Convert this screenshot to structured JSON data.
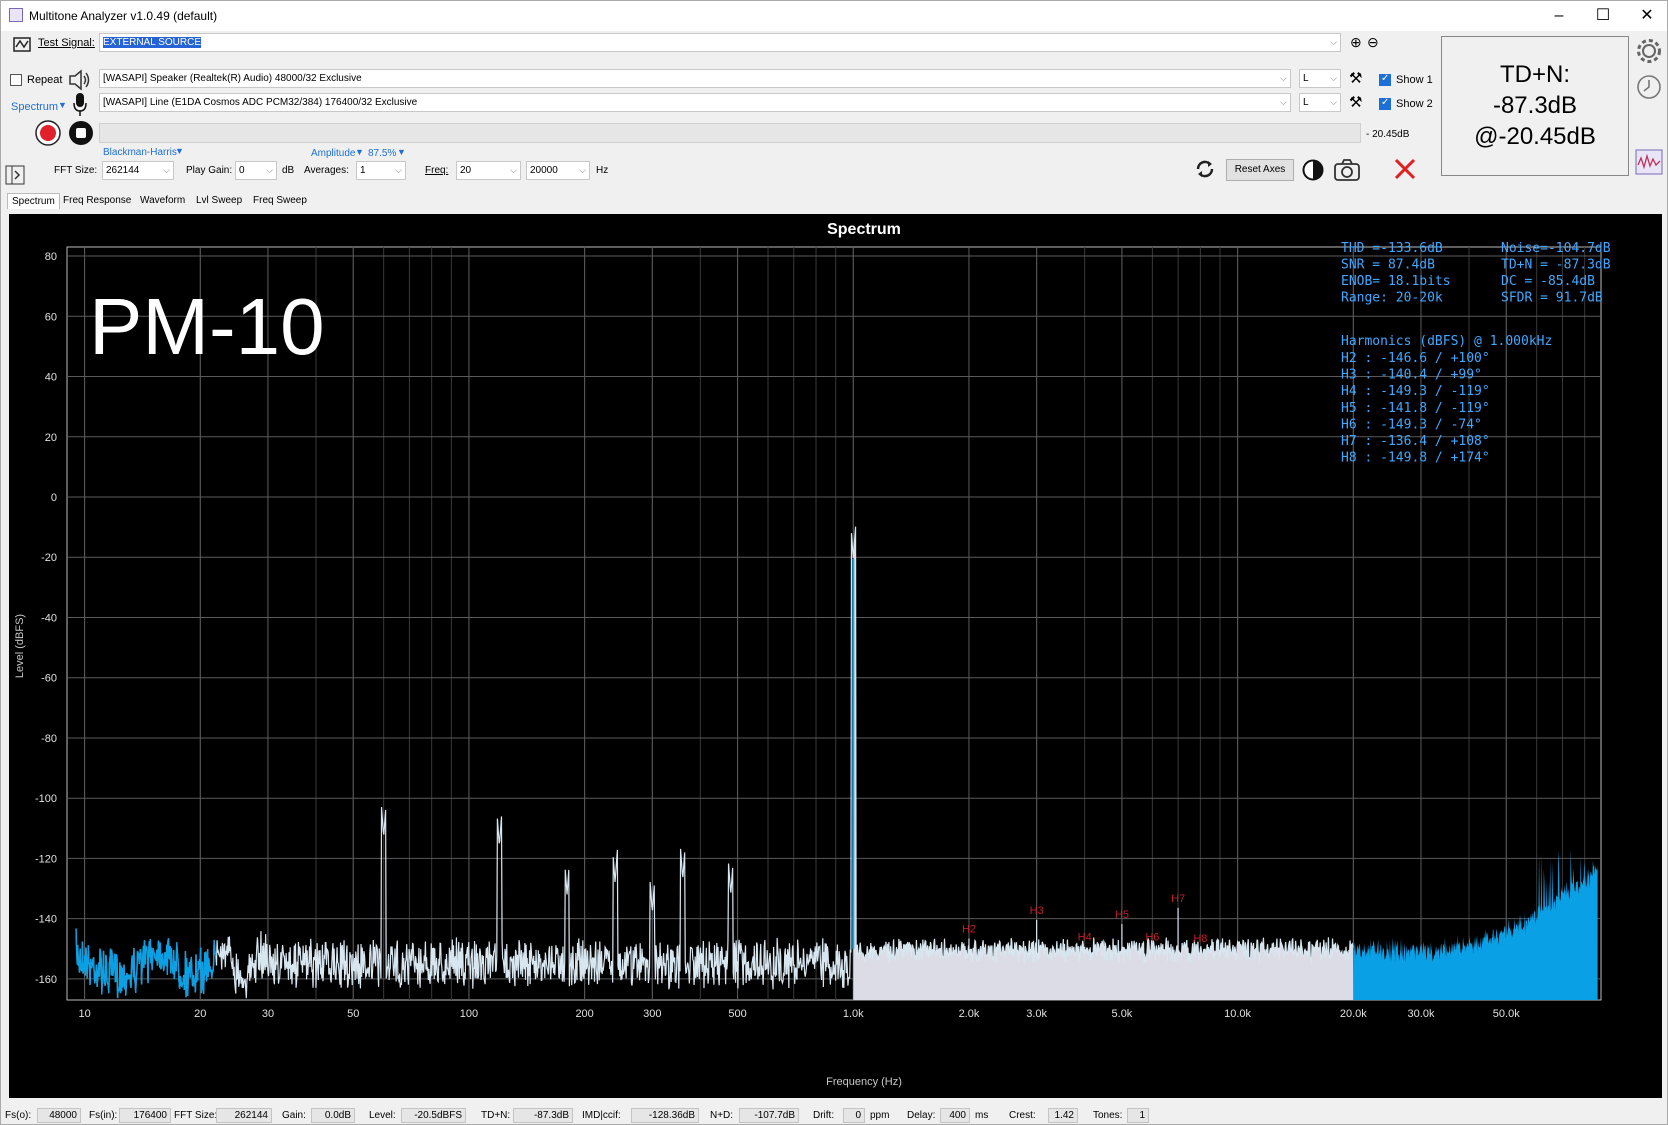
{
  "window": {
    "title": "Multitone Analyzer v1.0.49 (default)"
  },
  "toolbar": {
    "test_signal_label": "Test Signal:",
    "test_signal_value": "EXTERNAL SOURCE",
    "repeat_label": "Repeat",
    "spectrum_label": "Spectrum",
    "output_device": "[WASAPI] Speaker (Realtek(R) Audio) 48000/32 Exclusive",
    "input_device": "[WASAPI] Line (E1DA Cosmos ADC PCM32/384) 176400/32 Exclusive",
    "out_channel": "L",
    "in_channel": "L",
    "show1_label": "Show 1",
    "show2_label": "Show 2",
    "level_readout": "- 20.45dB",
    "window_func": "Blackman-Harris",
    "amplitude_label": "Amplitude",
    "amplitude_value": "87.5%",
    "fft_size_label": "FFT Size:",
    "fft_size_value": "262144",
    "play_gain_label": "Play Gain:",
    "play_gain_value": "0",
    "play_gain_unit": "dB",
    "averages_label": "Averages:",
    "averages_value": "1",
    "freq_label": "Freq:",
    "freq_from": "20",
    "freq_to": "20000",
    "freq_unit": "Hz",
    "reset_axes_label": "Reset Axes"
  },
  "tdn_panel": {
    "line1": "TD+N:",
    "line2": "-87.3dB",
    "line3": "@-20.45dB"
  },
  "tabs": [
    "Spectrum",
    "Freq Response",
    "Waveform",
    "Lvl Sweep",
    "Freq Sweep"
  ],
  "overlay_label": "PM-10",
  "stats": {
    "rows": [
      [
        "THD =-133.6dB",
        "Noise=-104.7dB"
      ],
      [
        "SNR =  87.4dB",
        "TD+N = -87.3dB"
      ],
      [
        "ENOB= 18.1bits",
        "DC   = -85.4dB"
      ],
      [
        "Range: 20-20k",
        "SFDR =  91.7dB"
      ]
    ],
    "harmonics_title": "Harmonics (dBFS) @ 1.000kHz",
    "harmonics": [
      "H2 :  -146.6 / +100°",
      "H3 :  -140.4 /  +99°",
      "H4 :  -149.3 / -119°",
      "H5 :  -141.8 / -119°",
      "H6 :  -149.3 /  -74°",
      "H7 :  -136.4 / +108°",
      "H8 :  -149.8 / +174°"
    ]
  },
  "chart_data": {
    "type": "line",
    "title": "Spectrum",
    "xlabel": "Frequency (Hz)",
    "ylabel": "Level (dBFS)",
    "xscale": "log",
    "xlim": [
      9,
      88200
    ],
    "ylim": [
      -167,
      83
    ],
    "grid": true,
    "y_ticks": [
      80,
      60,
      40,
      20,
      0,
      -20,
      -40,
      -60,
      -80,
      -100,
      -120,
      -140,
      -160
    ],
    "x_ticks": [
      {
        "v": 10,
        "label": "10"
      },
      {
        "v": 20,
        "label": "20"
      },
      {
        "v": 30,
        "label": "30"
      },
      {
        "v": 50,
        "label": "50"
      },
      {
        "v": 100,
        "label": "100"
      },
      {
        "v": 200,
        "label": "200"
      },
      {
        "v": 300,
        "label": "300"
      },
      {
        "v": 500,
        "label": "500"
      },
      {
        "v": 1000,
        "label": "1.0k"
      },
      {
        "v": 2000,
        "label": "2.0k"
      },
      {
        "v": 3000,
        "label": "3.0k"
      },
      {
        "v": 5000,
        "label": "5.0k"
      },
      {
        "v": 10000,
        "label": "10.0k"
      },
      {
        "v": 20000,
        "label": "20.0k"
      },
      {
        "v": 30000,
        "label": "30.0k"
      },
      {
        "v": 50000,
        "label": "50.0k"
      }
    ],
    "peaks": [
      {
        "x": 1000,
        "y": -20.5
      },
      {
        "x": 60,
        "y": -113
      },
      {
        "x": 120,
        "y": -116
      },
      {
        "x": 180,
        "y": -132
      },
      {
        "x": 240,
        "y": -128
      },
      {
        "x": 300,
        "y": -138
      },
      {
        "x": 360,
        "y": -127
      },
      {
        "x": 480,
        "y": -132
      }
    ],
    "harmonic_markers": [
      {
        "label": "H2",
        "x": 2000,
        "y": -146.6
      },
      {
        "label": "H3",
        "x": 3000,
        "y": -140.4
      },
      {
        "label": "H4",
        "x": 4000,
        "y": -149.3
      },
      {
        "label": "H5",
        "x": 5000,
        "y": -141.8
      },
      {
        "label": "H6",
        "x": 6000,
        "y": -149.3
      },
      {
        "label": "H7",
        "x": 7000,
        "y": -136.4
      },
      {
        "label": "H8",
        "x": 8000,
        "y": -149.8
      }
    ],
    "noise_floor_db": -150,
    "ultrasonic_peak": {
      "x": 80000,
      "y": -112
    },
    "colors": {
      "trace": "#d8e6f0",
      "fill": "#dcdce6",
      "ultrasonic": "#0aa0e6",
      "fundamental": "#1aa8e0",
      "markers": "#c0202a",
      "stats": "#40a8ff"
    }
  },
  "status": [
    {
      "label": "Fs(o):",
      "value": "48000"
    },
    {
      "label": "Fs(in):",
      "value": "176400"
    },
    {
      "label": "FFT Size:",
      "value": "262144"
    },
    {
      "label": "Gain:",
      "value": "0.0dB"
    },
    {
      "label": "Level:",
      "value": "-20.5dBFS"
    },
    {
      "label": "TD+N:",
      "value": "-87.3dB"
    },
    {
      "label": "IMD|ccif:",
      "value": "-128.36dB"
    },
    {
      "label": "N+D:",
      "value": "-107.7dB"
    },
    {
      "label": "Drift:",
      "value": "0",
      "unit": "ppm"
    },
    {
      "label": "Delay:",
      "value": "400",
      "unit": "ms"
    },
    {
      "label": "Crest:",
      "value": "1.42"
    },
    {
      "label": "Tones:",
      "value": "1"
    }
  ]
}
